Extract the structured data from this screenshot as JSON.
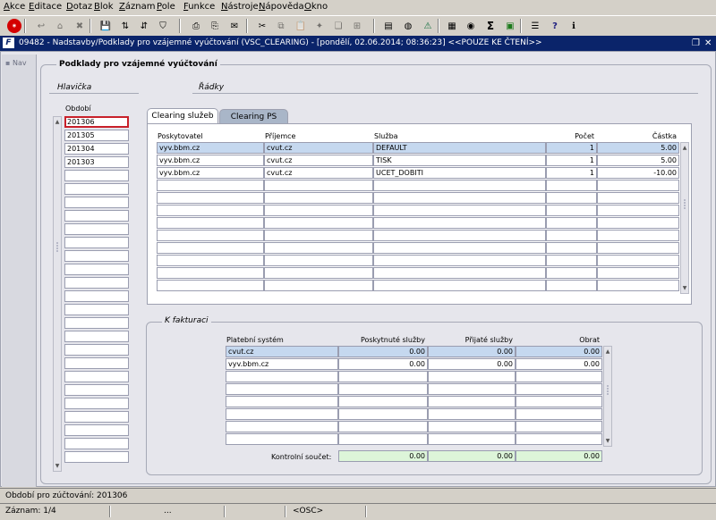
{
  "menu": [
    "Akce",
    "Editace",
    "Dotaz",
    "Blok",
    "Záznam",
    "Pole",
    "Funkce",
    "Nástroje",
    "Nápověda",
    "Okno"
  ],
  "toolbar": {
    "icons": [
      "exit-icon",
      "new-record-icon",
      "insert-icon",
      "delete-record-icon",
      "save-icon",
      "sort-ascending-icon",
      "sort-descending-icon",
      "filter-icon",
      "print-icon",
      "export-icon",
      "mail-icon",
      "cut-icon",
      "copy-icon",
      "paste-icon",
      "clear-icon",
      "duplicate-icon",
      "attach-icon",
      "document-icon",
      "globe-icon",
      "warning-icon",
      "calculator-icon",
      "coins-icon",
      "sum-icon",
      "excel-icon",
      "notes-icon",
      "help-icon",
      "about-icon"
    ]
  },
  "window": {
    "title": "09482 - Nadstavby/Podklady pro vzájemné vyúčtování (VSC_CLEARING) - [pondělí, 02.06.2014; 08:36:23] <<POUZE KE ČTENÍ>>",
    "restore_glyph": "❐",
    "close_glyph": "✕"
  },
  "nav": {
    "label": "Nav"
  },
  "main_frame": {
    "title": "Podklady pro vzájemné vyúčtování"
  },
  "header_section": {
    "title": "Hlavička",
    "column": "Období",
    "periods": [
      "201306",
      "201305",
      "201304",
      "201303"
    ],
    "empty_rows": 22
  },
  "rows_section": {
    "title": "Řádky"
  },
  "tabs": [
    {
      "label": "Clearing služeb",
      "active": true
    },
    {
      "label": "Clearing PS",
      "active": false
    }
  ],
  "clearing": {
    "columns": [
      "Poskytovatel",
      "Příjemce",
      "Služba",
      "Počet",
      "Částka"
    ],
    "rows": [
      [
        "vyv.bbm.cz",
        "cvut.cz",
        "DEFAULT",
        "1",
        "5.00"
      ],
      [
        "vyv.bbm.cz",
        "cvut.cz",
        "TISK",
        "1",
        "5.00"
      ],
      [
        "vyv.bbm.cz",
        "cvut.cz",
        "UCET_DOBITI",
        "1",
        "-10.00"
      ]
    ],
    "empty_rows": 9
  },
  "invoicing": {
    "title": "K fakturaci",
    "columns": [
      "Platební systém",
      "Poskytnuté služby",
      "Přijaté  služby",
      "Obrat"
    ],
    "rows": [
      [
        "cvut.cz",
        "0.00",
        "0.00",
        "0.00"
      ],
      [
        "vyv.bbm.cz",
        "0.00",
        "0.00",
        "0.00"
      ]
    ],
    "empty_rows": 6,
    "total_label": "Kontrolní součet:",
    "totals": [
      "0.00",
      "0.00",
      "0.00"
    ]
  },
  "status": {
    "line1": "Období pro zúčtování: 201306",
    "record": "Záznam: 1/4",
    "dots": "...",
    "mode": "<OSC>"
  }
}
